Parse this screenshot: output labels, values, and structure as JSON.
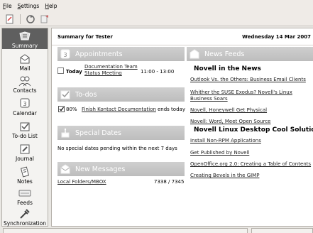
{
  "menubar": {
    "items": [
      {
        "key": "F",
        "rest": "ile"
      },
      {
        "key": "S",
        "rest": "ettings"
      },
      {
        "key": "H",
        "rest": "elp"
      }
    ]
  },
  "sidebar": {
    "items": [
      {
        "label": "Summary",
        "icon": "summary-icon"
      },
      {
        "label": "Mail",
        "icon": "mail-icon"
      },
      {
        "label": "Contacts",
        "icon": "contacts-icon"
      },
      {
        "label": "Calendar",
        "icon": "calendar-icon"
      },
      {
        "label": "To-do List",
        "icon": "todo-icon"
      },
      {
        "label": "Journal",
        "icon": "journal-icon"
      },
      {
        "label": "Notes",
        "icon": "notes-icon"
      },
      {
        "label": "Feeds",
        "icon": "feeds-icon"
      },
      {
        "label": "Synchronization",
        "icon": "synchronization-icon"
      }
    ]
  },
  "header": {
    "title": "Summary for Tester",
    "date": "Wednesday 14 Mar 2007"
  },
  "appointments": {
    "title": "Appointments",
    "day": "Today",
    "event_line1": "Documentation Team",
    "event_line2": "Status Meeting",
    "time": "11:00 - 13:00"
  },
  "todos": {
    "title": "To-dos",
    "percent": "80%",
    "task": "Finish Kontact Documentation",
    "due": "ends today"
  },
  "special_dates": {
    "title": "Special Dates",
    "message": "No special dates pending within the next 7 days"
  },
  "new_messages": {
    "title": "New Messages",
    "folder": "Local Folders/MBOX",
    "count": "7338 / 7345"
  },
  "news_feeds": {
    "title": "News Feeds",
    "groups": [
      {
        "name": "Novell in the News",
        "articles": [
          {
            "text": "Outlook Vs. the Others: Business Email Clients"
          },
          {
            "line1": "Whither the SUSE Exodus? Novell's Linux",
            "line2": "Business Soars"
          },
          {
            "text": "Novell, Honeywell Get Physical"
          },
          {
            "text": "Novell: Word, Meet Open Source"
          }
        ]
      },
      {
        "name": "Novell Linux Desktop Cool Solutions",
        "articles": [
          {
            "text": "Install Non-RPM Applications"
          },
          {
            "text": "Get Published by Novell"
          },
          {
            "text": "OpenOffice.org 2.0: Creating a Table of Contents"
          },
          {
            "text": "Creating Bevels in the GIMP"
          }
        ]
      }
    ]
  },
  "colors": {
    "section_bar": "#c4c4c4",
    "active_sidebar": "#5f5f5f"
  }
}
